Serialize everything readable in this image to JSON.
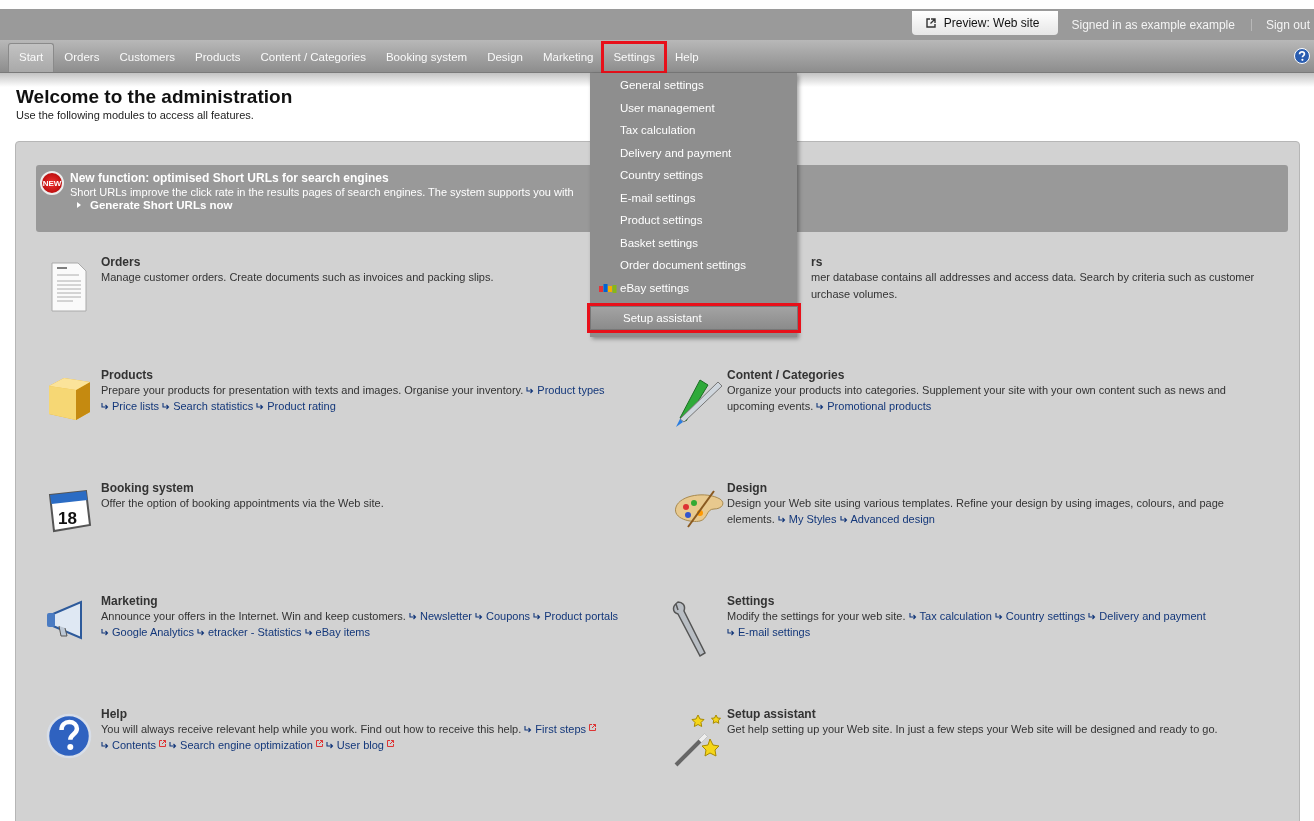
{
  "top_bar": {
    "preview_button": "Preview: Web site",
    "signed_in": "Signed in as example example",
    "sign_out": "Sign out"
  },
  "tabs": [
    {
      "label": "Start",
      "selected": true,
      "highlighted": false
    },
    {
      "label": "Orders",
      "selected": false,
      "highlighted": false
    },
    {
      "label": "Customers",
      "selected": false,
      "highlighted": false
    },
    {
      "label": "Products",
      "selected": false,
      "highlighted": false
    },
    {
      "label": "Content / Categories",
      "selected": false,
      "highlighted": false
    },
    {
      "label": "Booking system",
      "selected": false,
      "highlighted": false
    },
    {
      "label": "Design",
      "selected": false,
      "highlighted": false
    },
    {
      "label": "Marketing",
      "selected": false,
      "highlighted": false
    },
    {
      "label": "Settings",
      "selected": false,
      "highlighted": true
    },
    {
      "label": "Help",
      "selected": false,
      "highlighted": false
    }
  ],
  "settings_menu": [
    {
      "label": "General settings",
      "kind": "plain",
      "highlighted": false
    },
    {
      "label": "User management",
      "kind": "plain",
      "highlighted": false
    },
    {
      "label": "Tax calculation",
      "kind": "plain",
      "highlighted": false
    },
    {
      "label": "Delivery and payment",
      "kind": "plain",
      "highlighted": false
    },
    {
      "label": "Country settings",
      "kind": "plain",
      "highlighted": false
    },
    {
      "label": "E-mail settings",
      "kind": "plain",
      "highlighted": false
    },
    {
      "label": "Product settings",
      "kind": "plain",
      "highlighted": false
    },
    {
      "label": "Basket settings",
      "kind": "plain",
      "highlighted": false
    },
    {
      "label": "Order document settings",
      "kind": "plain",
      "highlighted": false
    },
    {
      "label": "eBay settings",
      "kind": "logo",
      "highlighted": false
    },
    {
      "label": "Setup assistant",
      "kind": "plain",
      "highlighted": true
    }
  ],
  "heading": {
    "title": "Welcome to the administration",
    "subtitle": "Use the following modules to access all features."
  },
  "banner": {
    "badge": "NEW",
    "title": "New function: optimised Short URLs for search engines",
    "text": "Short URLs improve the click rate in the results pages of search engines. The system supports you with",
    "link": "Generate Short URLs now"
  },
  "modules": [
    {
      "kind": "orders",
      "title": "Orders",
      "description": "Manage customer orders. Create documents such as invoices and packing slips."
    },
    {
      "kind": "partial",
      "title": "rs",
      "description_lines": [
        "mer database contains all addresses and access data. Search by criteria such as customer",
        "urchase volumes."
      ]
    },
    {
      "kind": "products",
      "title": "Products",
      "description": "Prepare your products for presentation with texts and images. Organise your inventory.",
      "links": [
        {
          "label": "Product types",
          "external": false
        },
        {
          "label": "Price lists",
          "external": false
        },
        {
          "label": "Search statistics",
          "external": false
        },
        {
          "label": "Product rating",
          "external": false
        }
      ]
    },
    {
      "kind": "content",
      "title": "Content / Categories",
      "description": "Organize your products into categories. Supplement your site with your own content such as news and upcoming events.",
      "links": [
        {
          "label": "Promotional products",
          "external": false
        }
      ]
    },
    {
      "kind": "booking",
      "title": "Booking system",
      "description": "Offer the option of booking appointments via the Web site.",
      "icon_label": "18"
    },
    {
      "kind": "design",
      "title": "Design",
      "description": "Design your Web site using various templates. Refine your design by using images, colours, and page elements.",
      "links": [
        {
          "label": "My Styles",
          "external": false
        },
        {
          "label": "Advanced design",
          "external": false
        }
      ]
    },
    {
      "kind": "marketing",
      "title": "Marketing",
      "description": "Announce your offers in the Internet. Win and keep customers.",
      "links": [
        {
          "label": "Newsletter",
          "external": false
        },
        {
          "label": "Coupons",
          "external": false
        },
        {
          "label": "Product portals",
          "external": false
        },
        {
          "label": "Google Analytics",
          "external": false
        },
        {
          "label": "etracker - Statistics",
          "external": false
        },
        {
          "label": "eBay items",
          "external": false
        }
      ]
    },
    {
      "kind": "settings",
      "title": "Settings",
      "description": "Modify the settings for your web site.",
      "links": [
        {
          "label": "Tax calculation",
          "external": false
        },
        {
          "label": "Country settings",
          "external": false
        },
        {
          "label": "Delivery and payment",
          "external": false
        },
        {
          "label": "E-mail settings",
          "external": false
        }
      ]
    },
    {
      "kind": "help",
      "title": "Help",
      "description": "You will always receive relevant help while you work. Find out how to receive this help.",
      "links": [
        {
          "label": "First steps",
          "external": true
        },
        {
          "label": "Contents",
          "external": true
        },
        {
          "label": "Search engine optimization",
          "external": true
        },
        {
          "label": "User blog",
          "external": true
        }
      ]
    },
    {
      "kind": "assistant",
      "title": "Setup assistant",
      "description": "Get help setting up your Web site. In just a few steps your Web site will be designed and ready to go."
    }
  ]
}
